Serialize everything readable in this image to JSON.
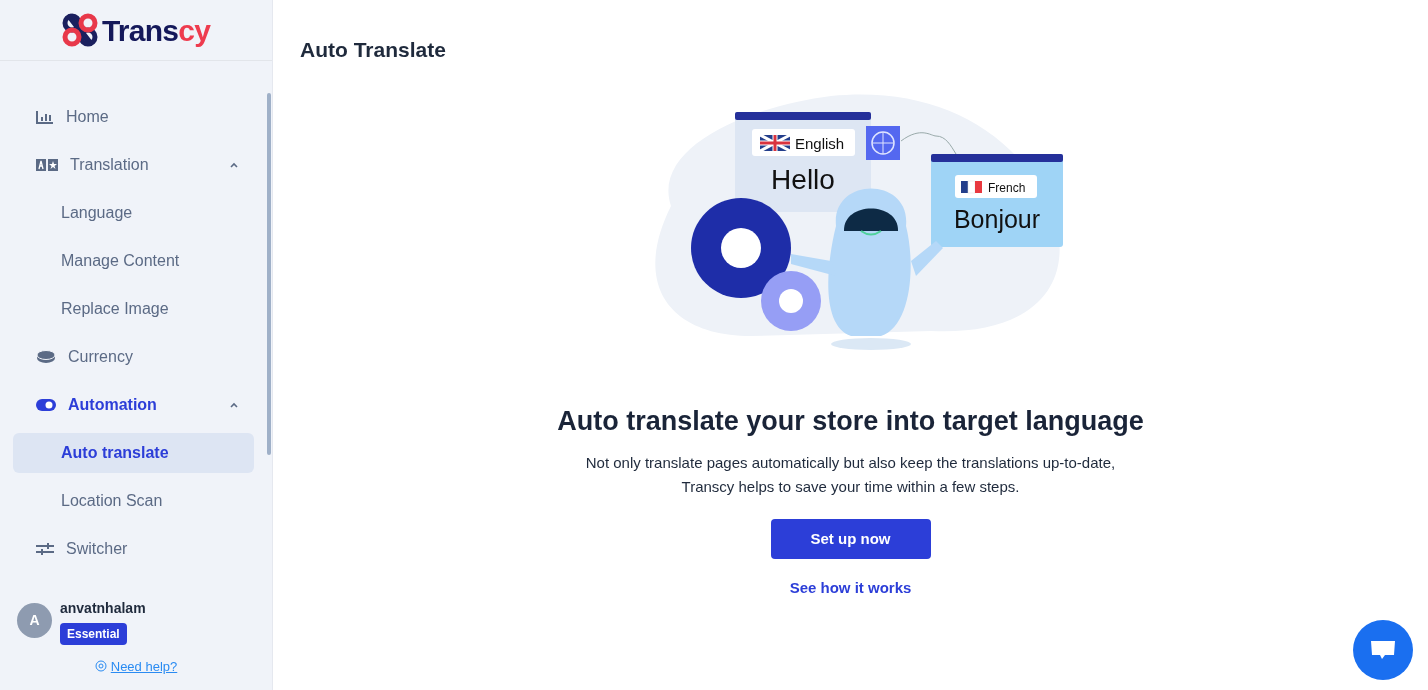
{
  "logo": {
    "text_main": "Trans",
    "text_accent": "cy"
  },
  "sidebar": {
    "items": [
      {
        "label": "Home",
        "kind": "home",
        "selected": false
      },
      {
        "label": "Translation",
        "kind": "translation",
        "selected": false,
        "expanded": true,
        "children": [
          {
            "label": "Language",
            "selected": false
          },
          {
            "label": "Manage Content",
            "selected": false
          },
          {
            "label": "Replace Image",
            "selected": false
          }
        ]
      },
      {
        "label": "Currency",
        "kind": "currency",
        "selected": false
      },
      {
        "label": "Automation",
        "kind": "automation",
        "selected": true,
        "expanded": true,
        "children": [
          {
            "label": "Auto translate",
            "selected": true
          },
          {
            "label": "Location Scan",
            "selected": false
          }
        ]
      },
      {
        "label": "Switcher",
        "kind": "switcher",
        "selected": false
      }
    ]
  },
  "user": {
    "initial": "A",
    "name": "anvatnhalam",
    "plan": "Essential"
  },
  "help_link": "Need help?",
  "page": {
    "title": "Auto Translate",
    "illustration": {
      "source_lang": "English",
      "source_word": "Hello",
      "target_lang": "French",
      "target_word": "Bonjour"
    },
    "heading": "Auto translate your store into target language",
    "description": [
      "Not only translate pages automatically but also keep the translations up-to-date,",
      "Transcy helps to save your time within a few steps."
    ],
    "primary_button": "Set up now",
    "secondary_link": "See how it works"
  }
}
